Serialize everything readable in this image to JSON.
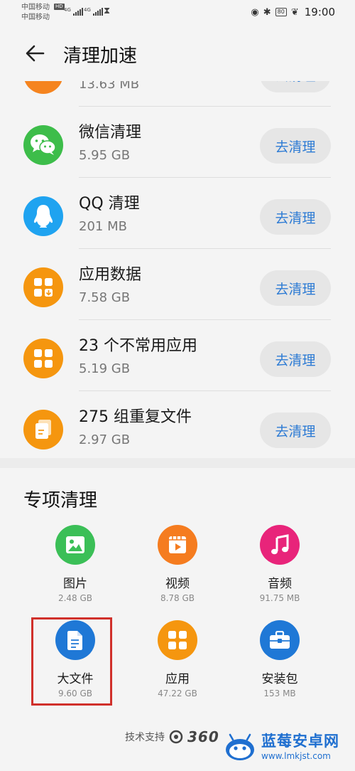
{
  "status_bar": {
    "carrier1": "中国移动",
    "carrier2": "中国移动",
    "hd_badge": "HD",
    "network1": "4G",
    "network2": "4G",
    "battery": "80",
    "time": "19:00"
  },
  "app_bar": {
    "title": "清理加速",
    "back_icon": "arrow-left-icon"
  },
  "list": {
    "partial_row": {
      "size": "13.63 MB",
      "button": "去清理",
      "color": "#f5841f"
    },
    "items": [
      {
        "title": "微信清理",
        "size": "5.95 GB",
        "button": "去清理",
        "icon": "wechat-icon",
        "color": "#3dbd4a"
      },
      {
        "title": "QQ 清理",
        "size": "201 MB",
        "button": "去清理",
        "icon": "qq-penguin-icon",
        "color": "#1fa3f0"
      },
      {
        "title": "应用数据",
        "size": "7.58 GB",
        "button": "去清理",
        "icon": "app-data-icon",
        "color": "#f5960f"
      },
      {
        "title": "23 个不常用应用",
        "size": "5.19 GB",
        "button": "去清理",
        "icon": "apps-grid-icon",
        "color": "#f5960f"
      },
      {
        "title": "275 组重复文件",
        "size": "2.97 GB",
        "button": "去清理",
        "icon": "duplicate-files-icon",
        "color": "#f5960f"
      }
    ]
  },
  "special": {
    "title": "专项清理",
    "categories": [
      {
        "name": "图片",
        "size": "2.48 GB",
        "icon": "image-icon",
        "color": "#3bbf57"
      },
      {
        "name": "视频",
        "size": "8.78 GB",
        "icon": "video-icon",
        "color": "#f57c1f"
      },
      {
        "name": "音频",
        "size": "91.75 MB",
        "icon": "music-note-icon",
        "color": "#e8247a"
      },
      {
        "name": "大文件",
        "size": "9.60 GB",
        "icon": "document-icon",
        "color": "#1f78d6"
      },
      {
        "name": "应用",
        "size": "47.22 GB",
        "icon": "apps-grid-icon",
        "color": "#f5960f"
      },
      {
        "name": "安装包",
        "size": "153 MB",
        "icon": "briefcase-icon",
        "color": "#1f78d6"
      }
    ],
    "footer_text": "技术支持",
    "footer_logo": "360"
  },
  "watermark": {
    "title": "蓝莓安卓网",
    "url": "www.lmkjst.com"
  },
  "colors": {
    "button_text": "#2d7bd4",
    "button_bg": "#e6e6e6",
    "highlight": "#d0302b"
  }
}
